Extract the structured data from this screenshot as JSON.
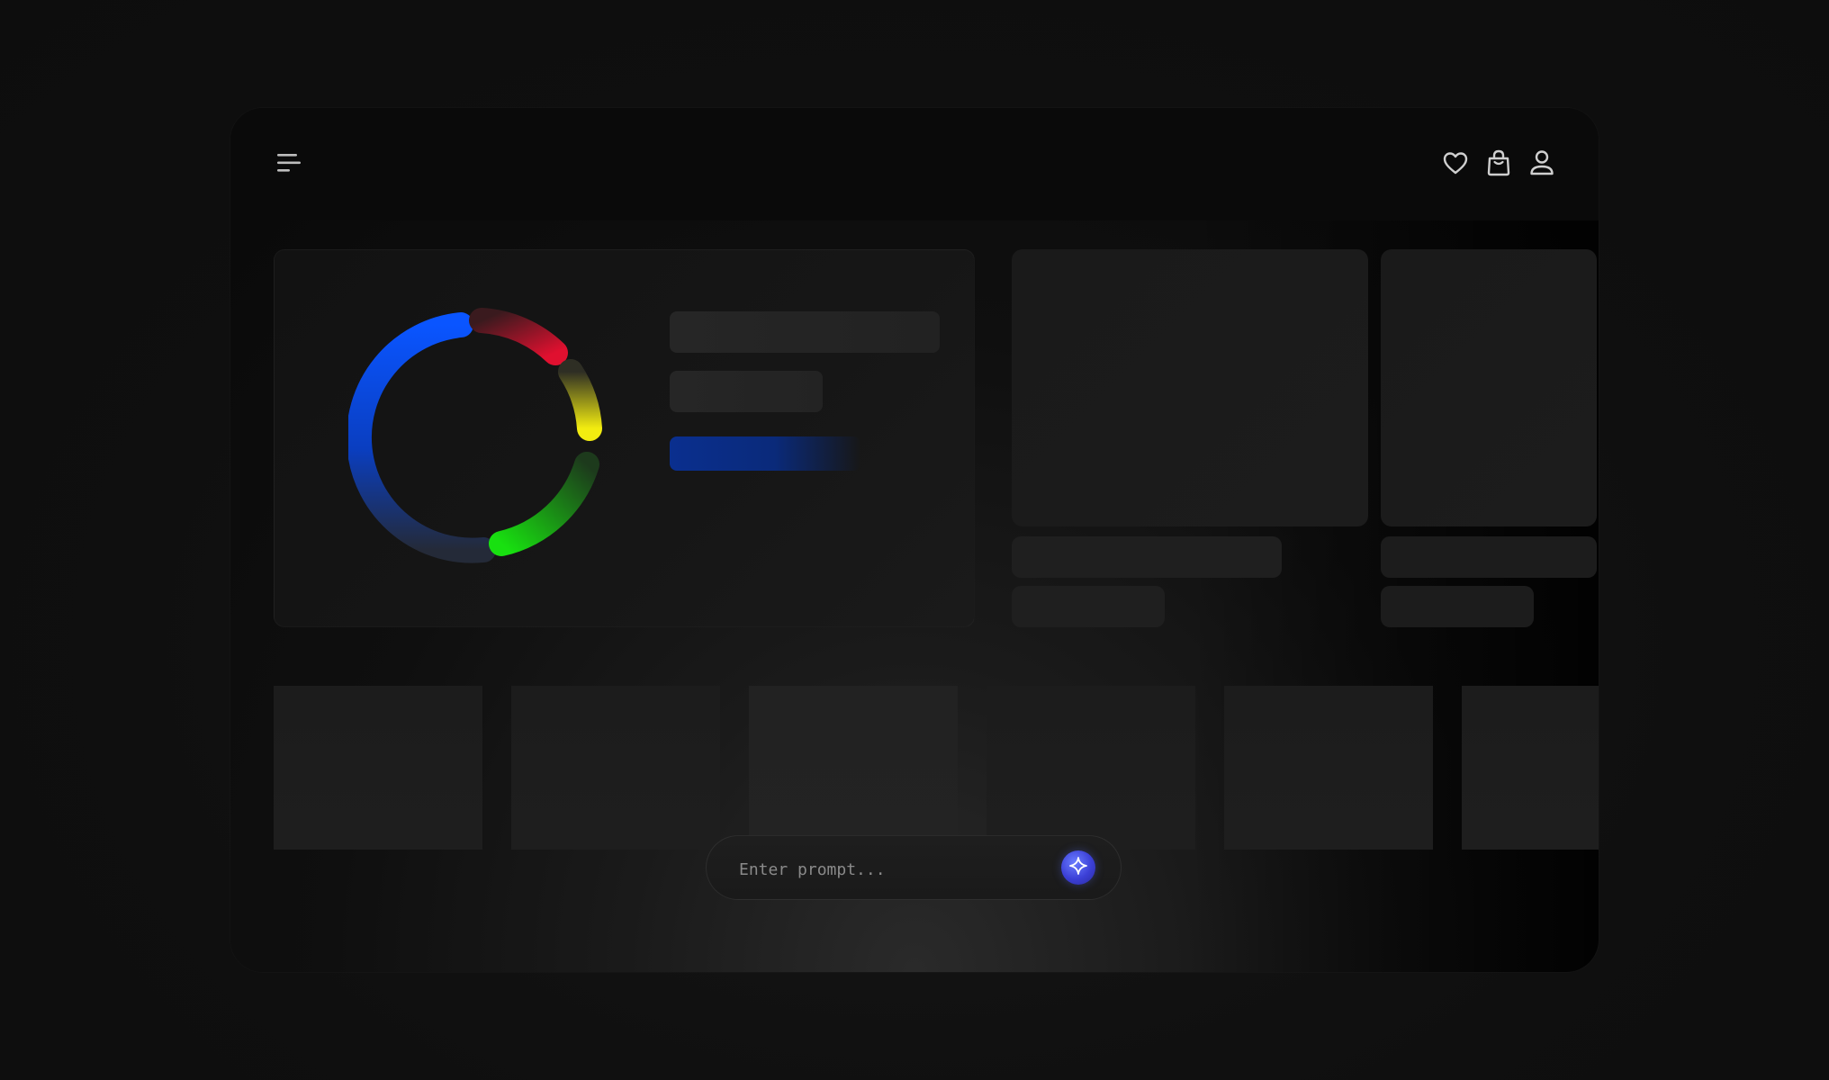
{
  "header": {
    "icons": [
      "menu-icon",
      "heart-icon",
      "shopping-bag-icon",
      "user-icon"
    ]
  },
  "prompt": {
    "placeholder": "Enter prompt...",
    "send_icon": "sparkle-icon"
  },
  "colors": {
    "ring_blue": "#0a55ff",
    "ring_red": "#e0102f",
    "ring_yellow": "#f2ec10",
    "ring_green": "#18e010",
    "progress_blue": "#0a2f8f",
    "send_button": "#3b3fd6"
  }
}
